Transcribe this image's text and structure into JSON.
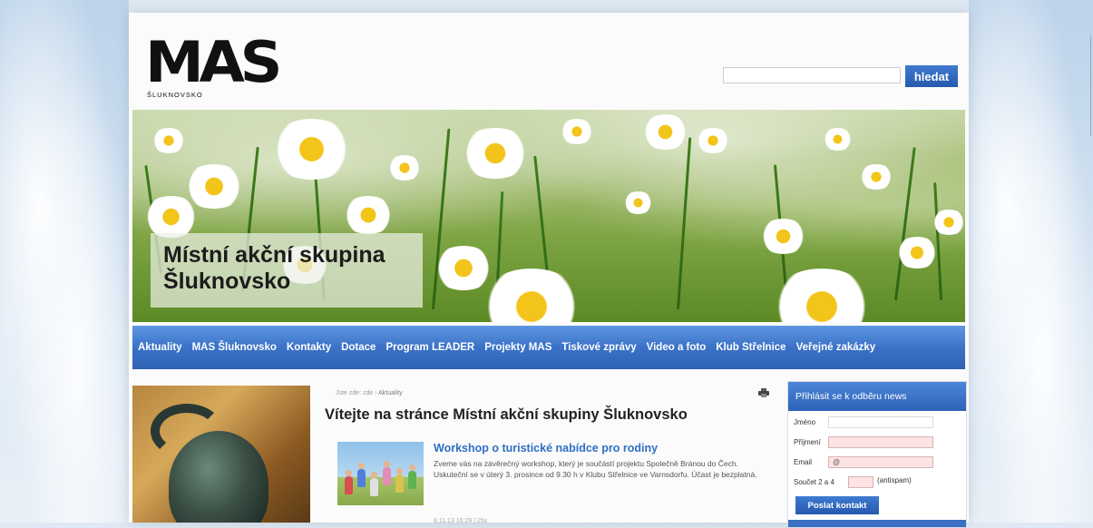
{
  "header": {
    "logo_text": "MAS",
    "logo_subtext": "ŠLUKNOVSKO",
    "search": {
      "value": "",
      "button_label": "hledat"
    }
  },
  "banner": {
    "caption_line1": "Místní akční skupina",
    "caption_line2": "Šluknovsko"
  },
  "nav": {
    "items": [
      "Aktuality",
      "MAS Šluknovsko",
      "Kontakty",
      "Dotace",
      "Program LEADER",
      "Projekty MAS",
      "Tiskové zprávy",
      "Video a foto",
      "Klub Střelnice",
      "Veřejné zakázky"
    ]
  },
  "content": {
    "breadcrumb_prefix": "Jste zde:",
    "breadcrumb_home": "zde",
    "breadcrumb_sep": "›",
    "breadcrumb_current": "Aktuality",
    "heading": "Vítejte na stránce Místní akční skupiny Šluknovsko",
    "article": {
      "title": "Workshop o turistické nabídce pro rodiny",
      "text": "Zveme vás na závěrečný workshop, který je součástí projektu Společně Bránou do Čech. Uskuteční se v úterý 3. prosince od 9.30 h v Klubu Střelnice ve Varnsdorfu. Účast je bezplatná.",
      "meta": "8.11.13 16:29 | 25x"
    }
  },
  "newsletter": {
    "title": "Přihlásit se k odběru news",
    "name_label": "Jméno",
    "surname_label": "Příjmení",
    "email_label": "Email",
    "email_value": "@",
    "sum_label": "Součet 2 a 4",
    "antispam_label": "(antispam)",
    "submit_label": "Poslat kontakt"
  },
  "colors": {
    "accent_blue": "#2f63b5",
    "link_blue": "#2f6fc4",
    "error_pink": "#fde3e3"
  }
}
